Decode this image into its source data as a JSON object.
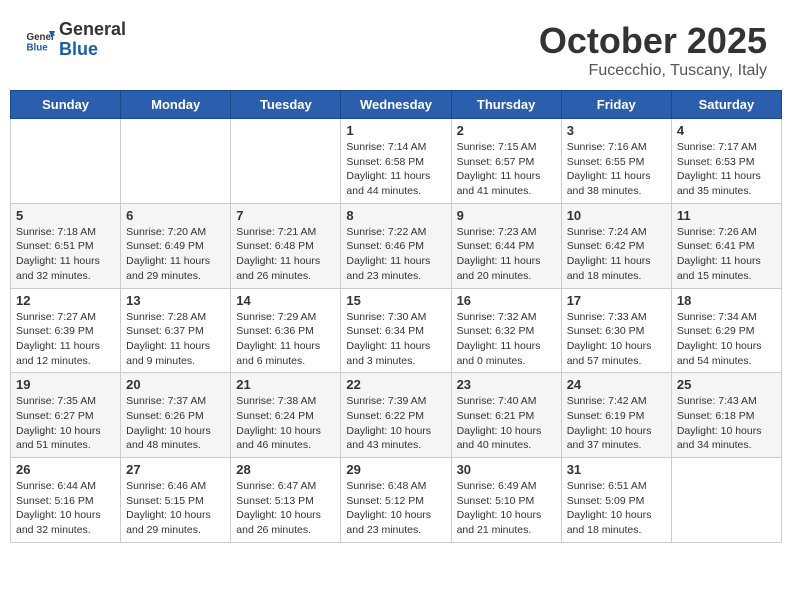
{
  "header": {
    "logo": {
      "line1": "General",
      "line2": "Blue"
    },
    "title": "October 2025",
    "location": "Fucecchio, Tuscany, Italy"
  },
  "weekdays": [
    "Sunday",
    "Monday",
    "Tuesday",
    "Wednesday",
    "Thursday",
    "Friday",
    "Saturday"
  ],
  "weeks": [
    [
      {
        "day": null
      },
      {
        "day": null
      },
      {
        "day": null
      },
      {
        "day": 1,
        "sunrise": "7:14 AM",
        "sunset": "6:58 PM",
        "daylight": "11 hours and 44 minutes."
      },
      {
        "day": 2,
        "sunrise": "7:15 AM",
        "sunset": "6:57 PM",
        "daylight": "11 hours and 41 minutes."
      },
      {
        "day": 3,
        "sunrise": "7:16 AM",
        "sunset": "6:55 PM",
        "daylight": "11 hours and 38 minutes."
      },
      {
        "day": 4,
        "sunrise": "7:17 AM",
        "sunset": "6:53 PM",
        "daylight": "11 hours and 35 minutes."
      }
    ],
    [
      {
        "day": 5,
        "sunrise": "7:18 AM",
        "sunset": "6:51 PM",
        "daylight": "11 hours and 32 minutes."
      },
      {
        "day": 6,
        "sunrise": "7:20 AM",
        "sunset": "6:49 PM",
        "daylight": "11 hours and 29 minutes."
      },
      {
        "day": 7,
        "sunrise": "7:21 AM",
        "sunset": "6:48 PM",
        "daylight": "11 hours and 26 minutes."
      },
      {
        "day": 8,
        "sunrise": "7:22 AM",
        "sunset": "6:46 PM",
        "daylight": "11 hours and 23 minutes."
      },
      {
        "day": 9,
        "sunrise": "7:23 AM",
        "sunset": "6:44 PM",
        "daylight": "11 hours and 20 minutes."
      },
      {
        "day": 10,
        "sunrise": "7:24 AM",
        "sunset": "6:42 PM",
        "daylight": "11 hours and 18 minutes."
      },
      {
        "day": 11,
        "sunrise": "7:26 AM",
        "sunset": "6:41 PM",
        "daylight": "11 hours and 15 minutes."
      }
    ],
    [
      {
        "day": 12,
        "sunrise": "7:27 AM",
        "sunset": "6:39 PM",
        "daylight": "11 hours and 12 minutes."
      },
      {
        "day": 13,
        "sunrise": "7:28 AM",
        "sunset": "6:37 PM",
        "daylight": "11 hours and 9 minutes."
      },
      {
        "day": 14,
        "sunrise": "7:29 AM",
        "sunset": "6:36 PM",
        "daylight": "11 hours and 6 minutes."
      },
      {
        "day": 15,
        "sunrise": "7:30 AM",
        "sunset": "6:34 PM",
        "daylight": "11 hours and 3 minutes."
      },
      {
        "day": 16,
        "sunrise": "7:32 AM",
        "sunset": "6:32 PM",
        "daylight": "11 hours and 0 minutes."
      },
      {
        "day": 17,
        "sunrise": "7:33 AM",
        "sunset": "6:30 PM",
        "daylight": "10 hours and 57 minutes."
      },
      {
        "day": 18,
        "sunrise": "7:34 AM",
        "sunset": "6:29 PM",
        "daylight": "10 hours and 54 minutes."
      }
    ],
    [
      {
        "day": 19,
        "sunrise": "7:35 AM",
        "sunset": "6:27 PM",
        "daylight": "10 hours and 51 minutes."
      },
      {
        "day": 20,
        "sunrise": "7:37 AM",
        "sunset": "6:26 PM",
        "daylight": "10 hours and 48 minutes."
      },
      {
        "day": 21,
        "sunrise": "7:38 AM",
        "sunset": "6:24 PM",
        "daylight": "10 hours and 46 minutes."
      },
      {
        "day": 22,
        "sunrise": "7:39 AM",
        "sunset": "6:22 PM",
        "daylight": "10 hours and 43 minutes."
      },
      {
        "day": 23,
        "sunrise": "7:40 AM",
        "sunset": "6:21 PM",
        "daylight": "10 hours and 40 minutes."
      },
      {
        "day": 24,
        "sunrise": "7:42 AM",
        "sunset": "6:19 PM",
        "daylight": "10 hours and 37 minutes."
      },
      {
        "day": 25,
        "sunrise": "7:43 AM",
        "sunset": "6:18 PM",
        "daylight": "10 hours and 34 minutes."
      }
    ],
    [
      {
        "day": 26,
        "sunrise": "6:44 AM",
        "sunset": "5:16 PM",
        "daylight": "10 hours and 32 minutes."
      },
      {
        "day": 27,
        "sunrise": "6:46 AM",
        "sunset": "5:15 PM",
        "daylight": "10 hours and 29 minutes."
      },
      {
        "day": 28,
        "sunrise": "6:47 AM",
        "sunset": "5:13 PM",
        "daylight": "10 hours and 26 minutes."
      },
      {
        "day": 29,
        "sunrise": "6:48 AM",
        "sunset": "5:12 PM",
        "daylight": "10 hours and 23 minutes."
      },
      {
        "day": 30,
        "sunrise": "6:49 AM",
        "sunset": "5:10 PM",
        "daylight": "10 hours and 21 minutes."
      },
      {
        "day": 31,
        "sunrise": "6:51 AM",
        "sunset": "5:09 PM",
        "daylight": "10 hours and 18 minutes."
      },
      {
        "day": null
      }
    ]
  ],
  "labels": {
    "sunrise": "Sunrise:",
    "sunset": "Sunset:",
    "daylight": "Daylight:"
  }
}
